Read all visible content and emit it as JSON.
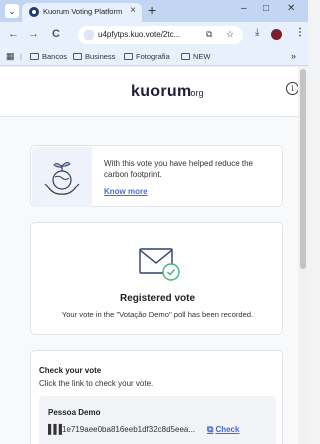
{
  "browser": {
    "tab_title": "Kuorum Voting Platform",
    "tab_close": "×",
    "new_tab": "+",
    "window_minimize": "–",
    "window_maximize": "□",
    "window_close": "✕",
    "back": "←",
    "forward": "→",
    "reload": "C",
    "url": "u4pfytps.kuo.vote/2tc...",
    "bookmarks": [
      {
        "label": "Bancos"
      },
      {
        "label": "Business"
      },
      {
        "label": "Fotografia"
      },
      {
        "label": "NEW"
      }
    ],
    "bookmarks_overflow": "»"
  },
  "header": {
    "logo": "kuorum",
    "logo_suffix": ".org",
    "info_icon": "i"
  },
  "eco": {
    "text": "With this vote you have helped reduce the carbon footprint.",
    "link": "Know more"
  },
  "vote": {
    "title": "Registered vote",
    "message": "Your vote in the \"Votação Demo\" poll has been recorded."
  },
  "check": {
    "title": "Check your vote",
    "subtitle": "Click the link to check your vote.",
    "voter_name": "Pessoa Demo",
    "hash": "1e719aee0ba816eeb1df32c8d5eea...",
    "link": "Check"
  },
  "colors": {
    "accent": "#4a6bd6",
    "success": "#3fb57a"
  }
}
